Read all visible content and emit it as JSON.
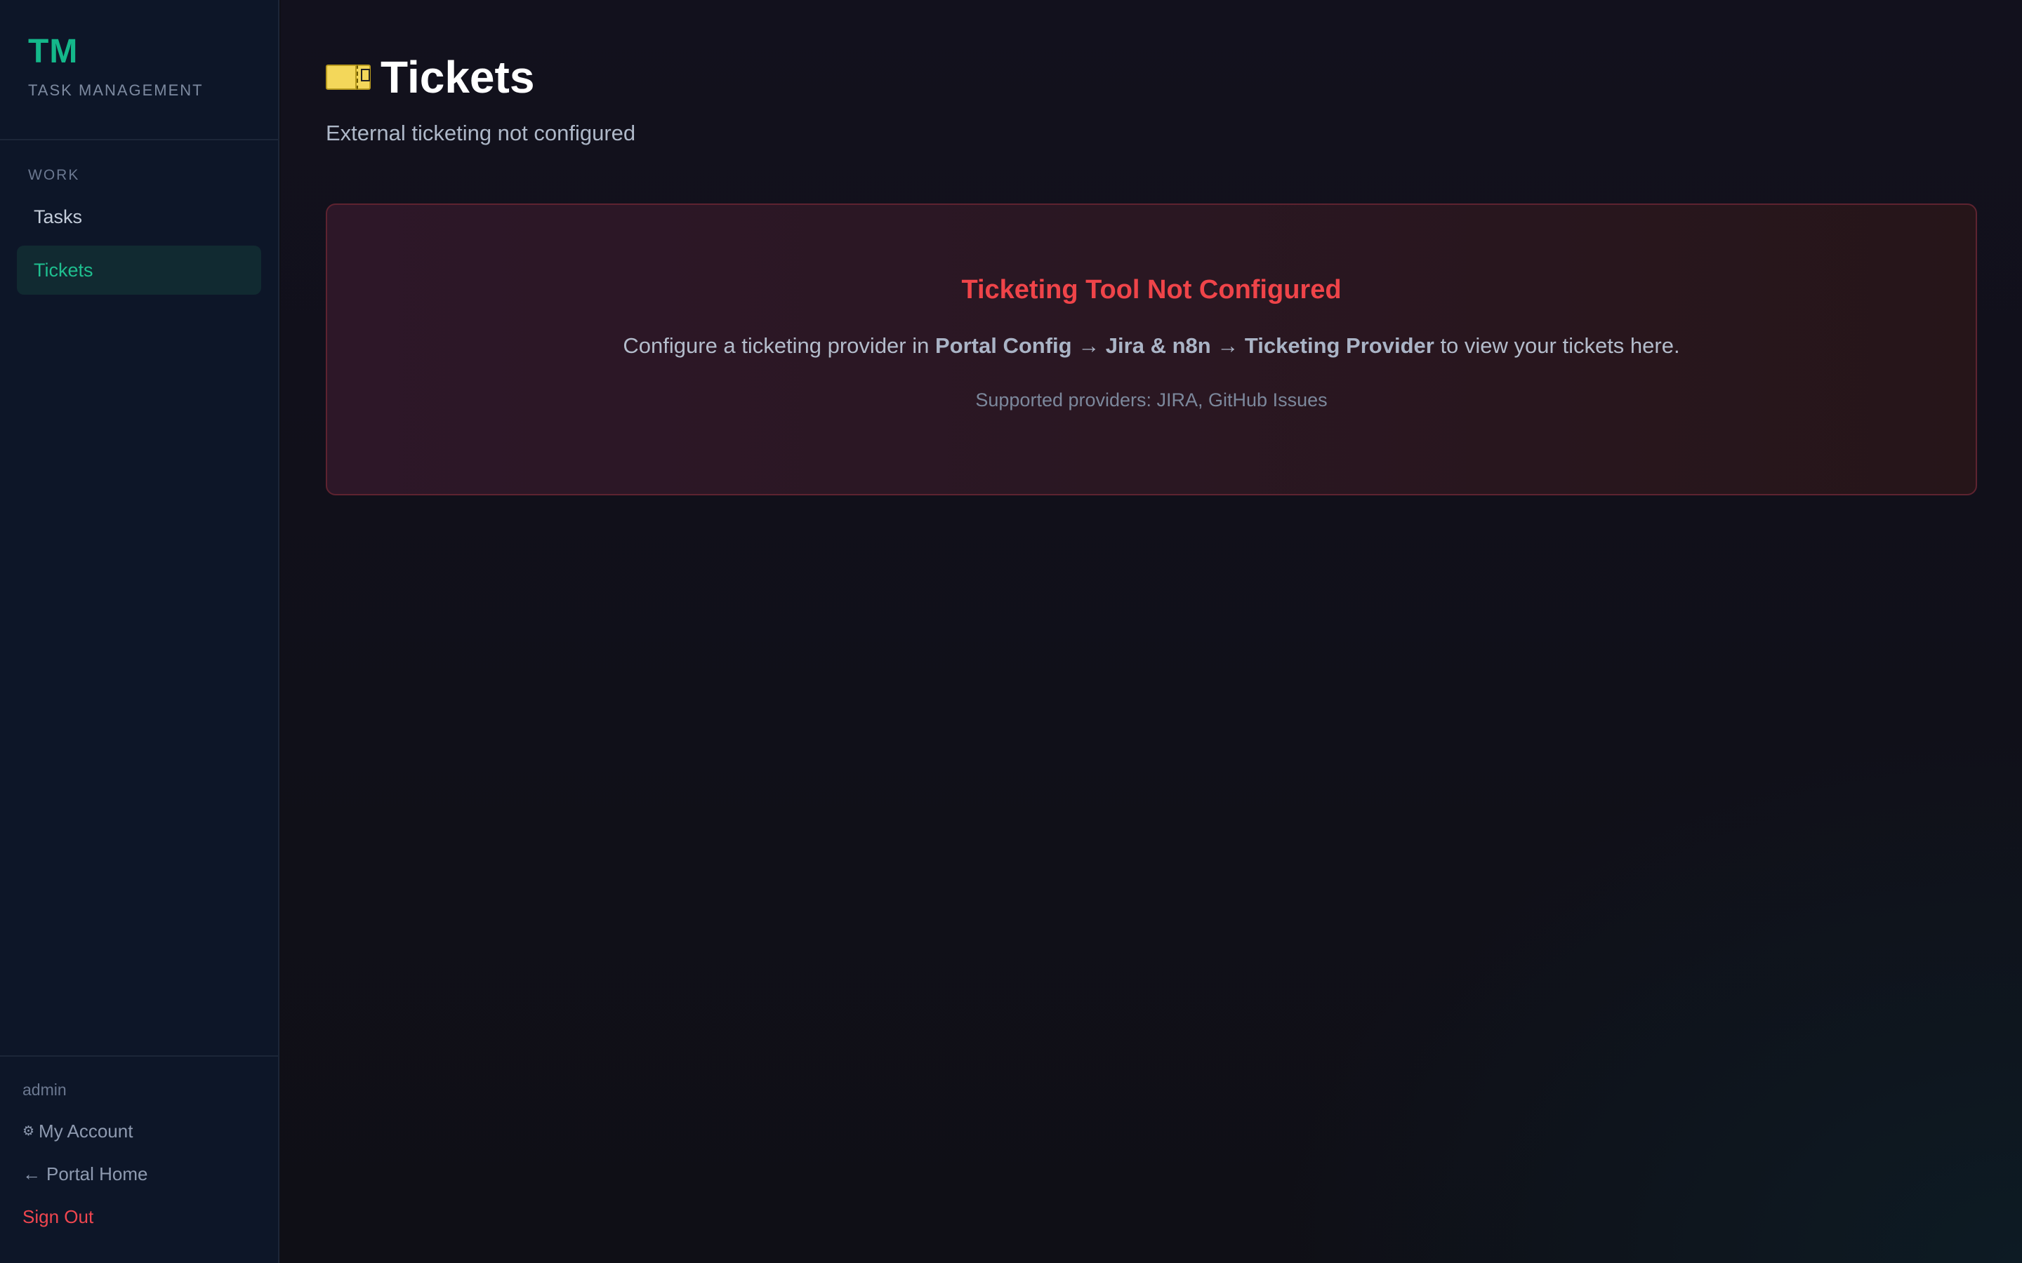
{
  "brand": {
    "logo": "TM",
    "subtitle": "TASK MANAGEMENT"
  },
  "nav": {
    "section_label": "WORK",
    "items": [
      {
        "label": "Tasks",
        "active": false
      },
      {
        "label": "Tickets",
        "active": true
      }
    ]
  },
  "footer": {
    "user": "admin",
    "my_account": {
      "icon": "gear-icon",
      "label": "My Account"
    },
    "portal_home": {
      "icon": "arrow-left-icon",
      "label": "Portal Home"
    },
    "sign_out": "Sign Out"
  },
  "page": {
    "icon": "ticket-icon",
    "title": "Tickets",
    "subtitle": "External ticketing not configured"
  },
  "alert": {
    "title": "Ticketing Tool Not Configured",
    "message_prefix": "Configure a ticketing provider in ",
    "message_path": "Portal Config → Jira & n8n → Ticketing Provider",
    "message_suffix": " to view your tickets here.",
    "providers": "Supported providers: JIRA, GitHub Issues"
  },
  "colors": {
    "accent": "#14b88a",
    "error": "#ef4449",
    "sign_out": "#f0464f"
  }
}
